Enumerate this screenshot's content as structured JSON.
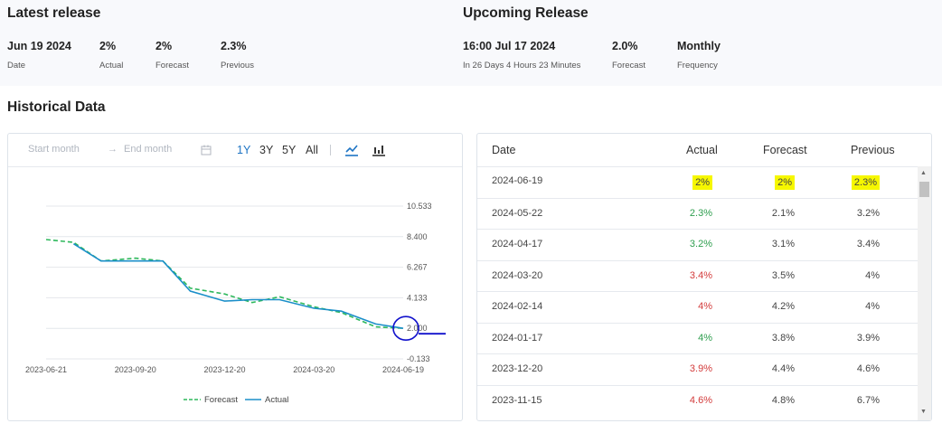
{
  "latest": {
    "title": "Latest release",
    "date_value": "Jun 19 2024",
    "date_label": "Date",
    "actual_value": "2%",
    "actual_label": "Actual",
    "forecast_value": "2%",
    "forecast_label": "Forecast",
    "previous_value": "2.3%",
    "previous_label": "Previous"
  },
  "upcoming": {
    "title": "Upcoming Release",
    "time_value": "16:00 Jul 17 2024",
    "time_label": "In 26 Days 4 Hours 23 Minutes",
    "forecast_value": "2.0%",
    "forecast_label": "Forecast",
    "frequency_value": "Monthly",
    "frequency_label": "Frequency"
  },
  "historical": {
    "title": "Historical Data",
    "start_placeholder": "Start month",
    "end_placeholder": "End month",
    "range_buttons": [
      "1Y",
      "3Y",
      "5Y",
      "All"
    ],
    "active_range": "1Y"
  },
  "chart_data": {
    "type": "line",
    "x_ticks": [
      "2023-06-21",
      "2023-09-20",
      "2023-12-20",
      "2024-03-20",
      "2024-06-19"
    ],
    "y_ticks": [
      "10.533",
      "8.400",
      "6.267",
      "4.133",
      "2.000",
      "-0.133"
    ],
    "ylim": [
      -0.133,
      10.533
    ],
    "legend": [
      "Forecast",
      "Actual"
    ],
    "legend_position": "bottom",
    "x": [
      "2023-06-21",
      "2023-07-19",
      "2023-08-16",
      "2023-09-20",
      "2023-10-18",
      "2023-11-15",
      "2023-12-20",
      "2024-01-17",
      "2024-02-14",
      "2024-03-20",
      "2024-04-17",
      "2024-05-22",
      "2024-06-19"
    ],
    "series": [
      {
        "name": "Forecast",
        "values": [
          8.2,
          8.0,
          6.7,
          6.9,
          6.7,
          4.8,
          4.4,
          3.8,
          4.2,
          3.5,
          3.1,
          2.1,
          2.0
        ]
      },
      {
        "name": "Actual",
        "values": [
          null,
          7.9,
          6.7,
          6.7,
          6.7,
          4.6,
          3.9,
          4.0,
          4.0,
          3.4,
          3.2,
          2.3,
          2.0
        ]
      }
    ],
    "colors": {
      "Forecast": "#2eb85c",
      "Actual": "#1b8fc9",
      "annotation": "#1111cc"
    }
  },
  "table": {
    "headers": [
      "Date",
      "Actual",
      "Forecast",
      "Previous"
    ],
    "rows": [
      {
        "date": "2024-06-19",
        "actual": "2%",
        "forecast": "2%",
        "previous": "2.3%",
        "trend": "",
        "highlight": true
      },
      {
        "date": "2024-05-22",
        "actual": "2.3%",
        "forecast": "2.1%",
        "previous": "3.2%",
        "trend": "up",
        "highlight": false
      },
      {
        "date": "2024-04-17",
        "actual": "3.2%",
        "forecast": "3.1%",
        "previous": "3.4%",
        "trend": "up",
        "highlight": false
      },
      {
        "date": "2024-03-20",
        "actual": "3.4%",
        "forecast": "3.5%",
        "previous": "4%",
        "trend": "down",
        "highlight": false
      },
      {
        "date": "2024-02-14",
        "actual": "4%",
        "forecast": "4.2%",
        "previous": "4%",
        "trend": "down",
        "highlight": false
      },
      {
        "date": "2024-01-17",
        "actual": "4%",
        "forecast": "3.8%",
        "previous": "3.9%",
        "trend": "up",
        "highlight": false
      },
      {
        "date": "2023-12-20",
        "actual": "3.9%",
        "forecast": "4.4%",
        "previous": "4.6%",
        "trend": "down",
        "highlight": false
      },
      {
        "date": "2023-11-15",
        "actual": "4.6%",
        "forecast": "4.8%",
        "previous": "6.7%",
        "trend": "down",
        "highlight": false
      }
    ]
  }
}
